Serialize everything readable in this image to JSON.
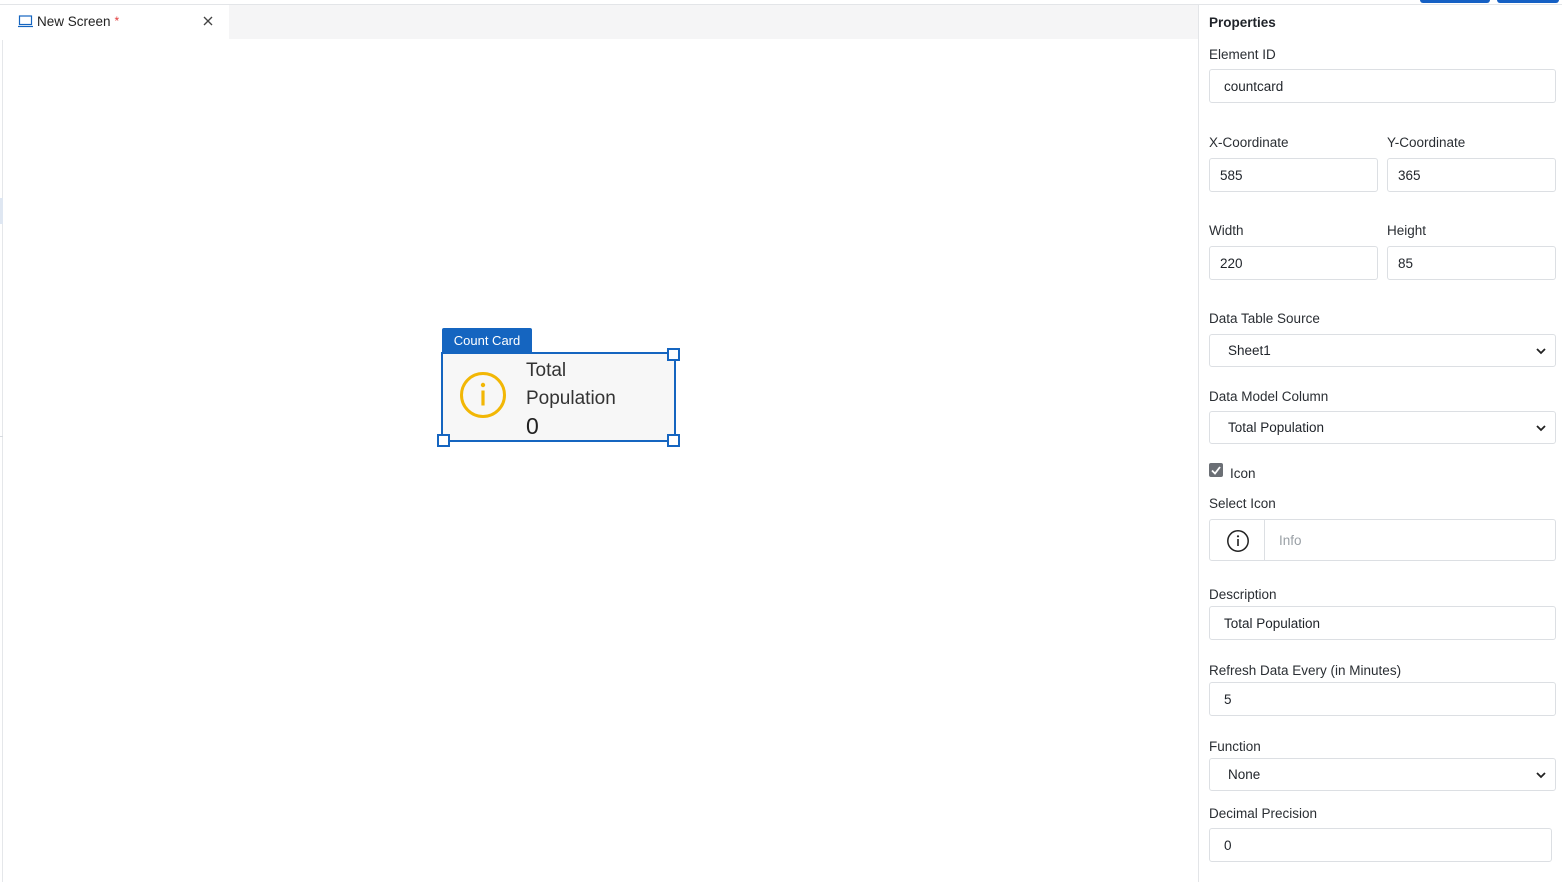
{
  "tab": {
    "title": "New Screen",
    "unsaved_marker": "*",
    "icon": "monitor-icon"
  },
  "widget": {
    "type_label": "Count Card",
    "description": "Total Population",
    "value": "0",
    "icon": "info-circle-icon",
    "icon_color": "#f2b705",
    "accent_color": "#1565c0"
  },
  "properties": {
    "title": "Properties",
    "element_id": {
      "label": "Element ID",
      "value": "countcard"
    },
    "x_coordinate": {
      "label": "X-Coordinate",
      "value": "585"
    },
    "y_coordinate": {
      "label": "Y-Coordinate",
      "value": "365"
    },
    "width": {
      "label": "Width",
      "value": "220"
    },
    "height": {
      "label": "Height",
      "value": "85"
    },
    "data_table_source": {
      "label": "Data Table Source",
      "value": "Sheet1"
    },
    "data_model_column": {
      "label": "Data Model Column",
      "value": "Total Population"
    },
    "icon_toggle": {
      "label": "Icon",
      "checked": true
    },
    "select_icon": {
      "label": "Select Icon",
      "value": "Info",
      "icon": "info-circle-icon"
    },
    "description": {
      "label": "Description",
      "value": "Total Population"
    },
    "refresh": {
      "label": "Refresh Data Every (in Minutes)",
      "value": "5"
    },
    "function": {
      "label": "Function",
      "value": "None"
    },
    "decimal_precision": {
      "label": "Decimal Precision",
      "value": "0"
    }
  }
}
